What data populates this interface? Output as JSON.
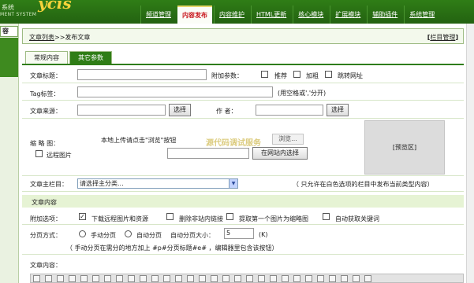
{
  "header": {
    "brand": "ycis",
    "logo_line1": "系统",
    "logo_line2": "MENT SYSTEM",
    "nav": [
      {
        "label": "频道管理"
      },
      {
        "label": "内容发布",
        "active": true
      },
      {
        "label": "内容维护"
      },
      {
        "label": "HTML更新"
      },
      {
        "label": "核心模块"
      },
      {
        "label": "扩展模块"
      },
      {
        "label": "辅助插件"
      },
      {
        "label": "系统管理"
      }
    ]
  },
  "sidebar": {
    "label": "容"
  },
  "breadcrumb": {
    "link": "文章列表",
    "sep": ">>",
    "current": "发布文章"
  },
  "column_manage": {
    "open": "[",
    "label": "栏目管理",
    "close": "]"
  },
  "tabs": [
    "常规内容",
    "其它参数"
  ],
  "form": {
    "title_label": "文章标题：",
    "extra_label": "附加参数：",
    "extra_options": [
      "推荐",
      "加粗",
      "跳转网址"
    ],
    "tag_label": "Tag标签：",
    "tag_hint": "(用空格或','分开)",
    "source_label": "文章来源：",
    "choose_button": "选择",
    "author_label": "作    者：",
    "thumb_label": "缩 略 图：",
    "remote_image": "远程图片",
    "upload_hint": "本地上传请点击\"浏览\"按钮",
    "browse_button": "浏览...",
    "site_choose_button": "在网站内选择",
    "preview_label": "[预览区]",
    "watermark": "源代码调试服务",
    "main_column_label": "文章主栏目：",
    "main_column_select": "请选择主分类...",
    "main_column_hint": "（ 只允许在白色选项的栏目中发布当前类型内容）",
    "content_section": "文章内容",
    "attach_label": "附加选项：",
    "attach_options": [
      {
        "label": "下载远程图片和资源",
        "checked": true
      },
      {
        "label": "删除非站内链接",
        "checked": false
      },
      {
        "label": "提取第一个图片为缩略图",
        "checked": false
      },
      {
        "label": "自动获取关键词",
        "checked": false
      }
    ],
    "paging_label": "分页方式：",
    "paging_manual": "手动分页",
    "paging_auto": "自动分页",
    "paging_size_label": "自动分页大小：",
    "paging_size_value": "5",
    "paging_size_unit": "(K)",
    "paging_hint": "（ 手动分页在需分的地方加上 #p#分页标题#e# ，编辑器里包含该按钮）",
    "body_label": "文章内容："
  }
}
